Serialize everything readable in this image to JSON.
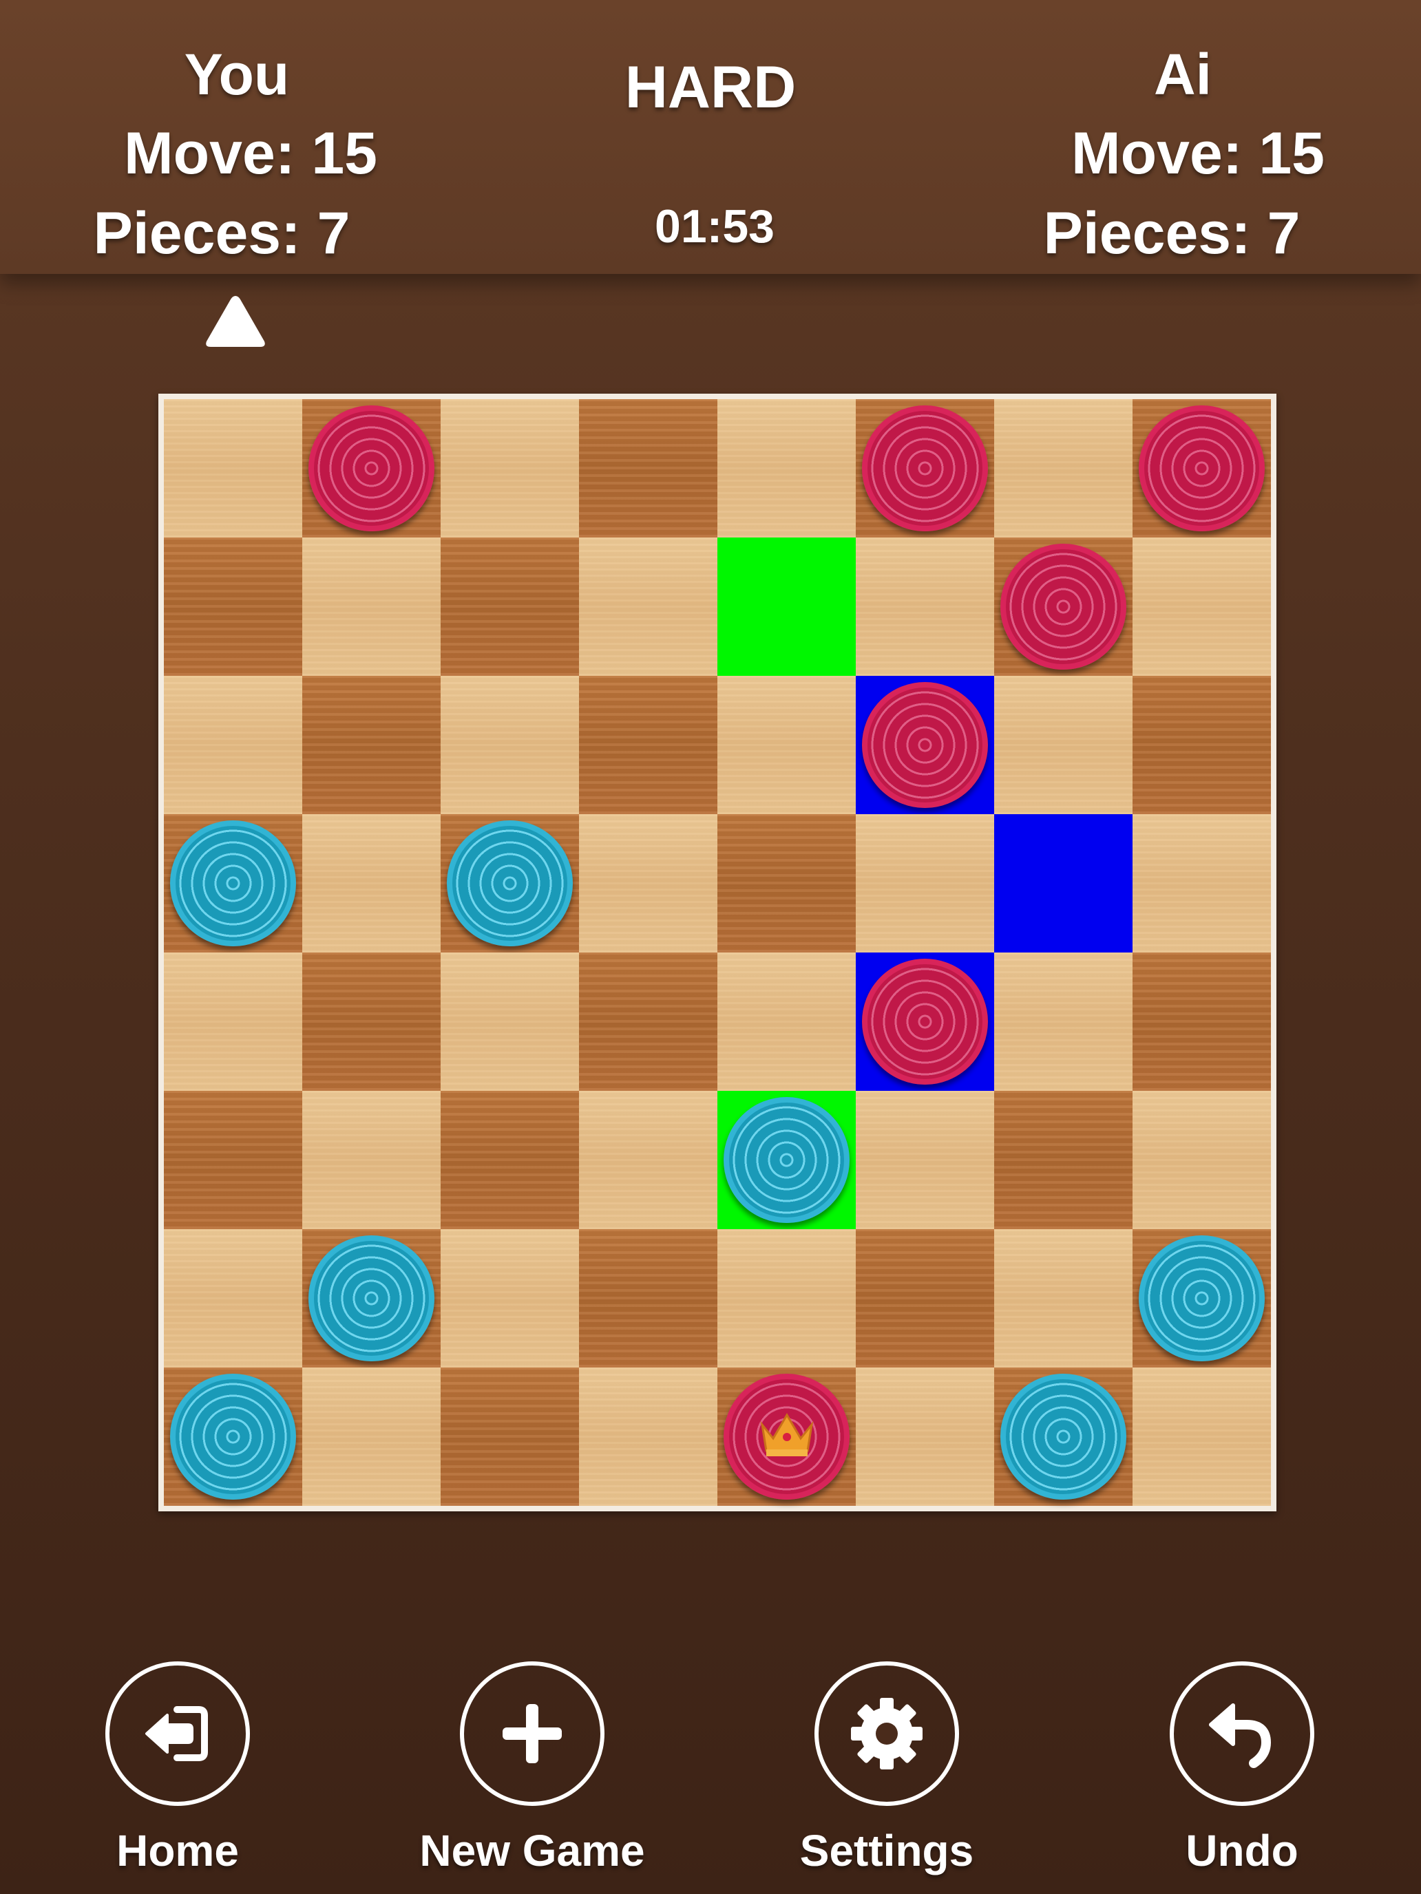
{
  "header": {
    "you": {
      "label": "You",
      "move": "Move: 15",
      "pieces": "Pieces:  7"
    },
    "ai": {
      "label": "Ai",
      "move": "Move: 15",
      "pieces": "Pieces:  7"
    },
    "difficulty": "HARD",
    "timer": "01:53"
  },
  "turn_indicator_icon": "triangle-up-icon",
  "board": {
    "size": 8,
    "colors": {
      "light": "#e8c28c",
      "dark": "#b86e36",
      "highlight_green": "#00f700",
      "highlight_blue": "#0000f0",
      "red_piece": "#c8174a",
      "blue_piece": "#1fa3c2"
    },
    "highlights": [
      {
        "row": 1,
        "col": 4,
        "color": "green"
      },
      {
        "row": 2,
        "col": 5,
        "color": "blue"
      },
      {
        "row": 3,
        "col": 6,
        "color": "blue"
      },
      {
        "row": 4,
        "col": 5,
        "color": "blue"
      },
      {
        "row": 5,
        "col": 4,
        "color": "green"
      }
    ],
    "pieces": [
      {
        "row": 0,
        "col": 1,
        "color": "red"
      },
      {
        "row": 0,
        "col": 5,
        "color": "red"
      },
      {
        "row": 0,
        "col": 7,
        "color": "red"
      },
      {
        "row": 1,
        "col": 6,
        "color": "red"
      },
      {
        "row": 2,
        "col": 5,
        "color": "red"
      },
      {
        "row": 3,
        "col": 0,
        "color": "blue"
      },
      {
        "row": 3,
        "col": 2,
        "color": "blue"
      },
      {
        "row": 4,
        "col": 5,
        "color": "red"
      },
      {
        "row": 5,
        "col": 4,
        "color": "blue"
      },
      {
        "row": 6,
        "col": 1,
        "color": "blue"
      },
      {
        "row": 6,
        "col": 7,
        "color": "blue"
      },
      {
        "row": 7,
        "col": 0,
        "color": "blue"
      },
      {
        "row": 7,
        "col": 4,
        "color": "red",
        "king": true
      },
      {
        "row": 7,
        "col": 6,
        "color": "blue"
      }
    ]
  },
  "buttons": [
    {
      "label": "Home",
      "icon": "home-exit-icon"
    },
    {
      "label": "New Game",
      "icon": "plus-icon"
    },
    {
      "label": "Settings",
      "icon": "gear-icon"
    },
    {
      "label": "Undo",
      "icon": "undo-arrow-icon"
    }
  ]
}
